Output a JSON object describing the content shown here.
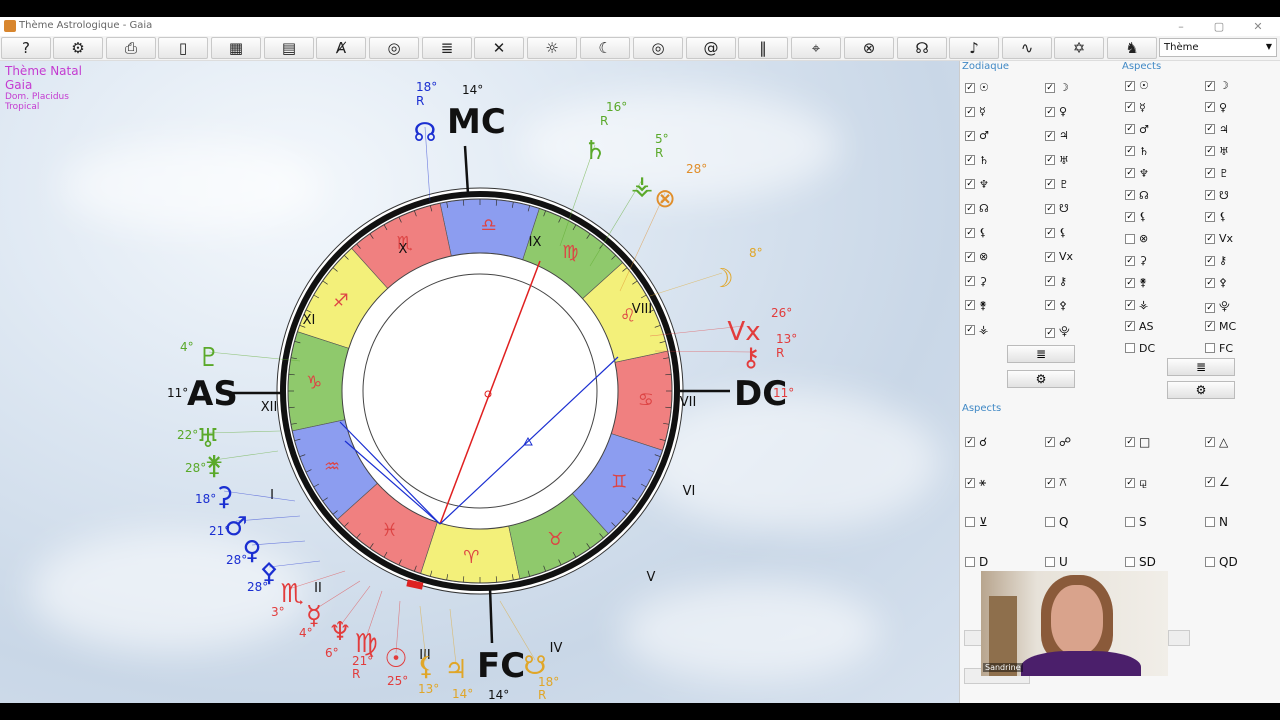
{
  "window": {
    "title": "Thème Astrologique - Gaia"
  },
  "toolbar": {
    "buttons": [
      {
        "name": "help-button",
        "glyph": "?"
      },
      {
        "name": "settings-button",
        "glyph": "⚙"
      },
      {
        "name": "print-button",
        "glyph": "⎙"
      },
      {
        "name": "export-button",
        "glyph": "▯"
      },
      {
        "name": "calculator-button",
        "glyph": "▦"
      },
      {
        "name": "clipboard-button",
        "glyph": "▤"
      },
      {
        "name": "compass-button",
        "glyph": "Ⱥ"
      },
      {
        "name": "spiral-target-button",
        "glyph": "◎"
      },
      {
        "name": "table-button",
        "glyph": "≣"
      },
      {
        "name": "transit-button",
        "glyph": "✕"
      },
      {
        "name": "calendar-sun-button",
        "glyph": "☼"
      },
      {
        "name": "calendar-moon-button",
        "glyph": "☾"
      },
      {
        "name": "circles-button",
        "glyph": "◎"
      },
      {
        "name": "spiral-button",
        "glyph": "@"
      },
      {
        "name": "bars-button",
        "glyph": "‖"
      },
      {
        "name": "cursor-button",
        "glyph": "⌖"
      },
      {
        "name": "cross-circle-button",
        "glyph": "⊗"
      },
      {
        "name": "node-button",
        "glyph": "☊"
      },
      {
        "name": "guitar-button",
        "glyph": "♪"
      },
      {
        "name": "serpent-button",
        "glyph": "∿"
      },
      {
        "name": "star-button",
        "glyph": "✡"
      },
      {
        "name": "family-button",
        "glyph": "♞"
      }
    ],
    "theme_select": "Thème"
  },
  "chart": {
    "info": {
      "title": "Thème Natal",
      "name": "Gaia",
      "houses": "Dom. Placidus",
      "zodiac": "Tropical"
    },
    "houses": [
      "I",
      "II",
      "III",
      "IV",
      "V",
      "VI",
      "VII",
      "VIII",
      "IX",
      "X",
      "XI",
      "XII"
    ],
    "angles": {
      "mc": {
        "glyph": "MC",
        "deg": "14°"
      },
      "dc": {
        "glyph": "DC",
        "deg": "11°"
      },
      "as": {
        "glyph": "AS",
        "deg": "11°"
      },
      "fc": {
        "glyph": "FC",
        "deg": "14°"
      }
    },
    "planets": [
      {
        "glyph": "☊",
        "deg": "18°",
        "retro": "R",
        "color": "#1b2fd1"
      },
      {
        "glyph": "♄",
        "deg": "16°",
        "retro": "R",
        "color": "#5aa92a"
      },
      {
        "glyph": "⚶",
        "deg": "5°",
        "retro": "R",
        "color": "#5aa92a"
      },
      {
        "glyph": "⊗",
        "deg": "28°",
        "retro": "",
        "color": "#e08e2b"
      },
      {
        "glyph": "☽",
        "deg": "8°",
        "retro": "",
        "color": "#e0a628"
      },
      {
        "glyph": "Vx",
        "deg": "26°",
        "retro": "",
        "color": "#e23c3c"
      },
      {
        "glyph": "⚷",
        "deg": "13°",
        "retro": "R",
        "color": "#e23c3c"
      },
      {
        "glyph": "♇",
        "deg": "4°",
        "retro": "",
        "color": "#5aa92a"
      },
      {
        "glyph": "♅",
        "deg": "22°",
        "retro": "",
        "color": "#5aa92a"
      },
      {
        "glyph": "⚵",
        "deg": "28°",
        "retro": "",
        "color": "#5aa92a"
      },
      {
        "glyph": "⚳",
        "deg": "18°",
        "retro": "",
        "color": "#1b2fd1"
      },
      {
        "glyph": "♂",
        "deg": "21°",
        "retro": "",
        "color": "#1b2fd1"
      },
      {
        "glyph": "♀",
        "deg": "28°",
        "retro": "",
        "color": "#1b2fd1"
      },
      {
        "glyph": "⚴",
        "deg": "28°",
        "retro": "",
        "color": "#1b2fd1"
      },
      {
        "glyph": "♏",
        "deg": "3°",
        "retro": "",
        "color": "#e23c3c"
      },
      {
        "glyph": "☿",
        "deg": "4°",
        "retro": "",
        "color": "#e23c3c"
      },
      {
        "glyph": "♆",
        "deg": "6°",
        "retro": "",
        "color": "#e23c3c"
      },
      {
        "glyph": "♍",
        "deg": "21°",
        "retro": "R",
        "color": "#e23c3c"
      },
      {
        "glyph": "☉",
        "deg": "25°",
        "retro": "",
        "color": "#e23c3c"
      },
      {
        "glyph": "⚸",
        "deg": "13°",
        "retro": "",
        "color": "#e0a628"
      },
      {
        "glyph": "♃",
        "deg": "14°",
        "retro": "",
        "color": "#e0a628"
      },
      {
        "glyph": "☋",
        "deg": "18°",
        "retro": "R",
        "color": "#e0a628"
      }
    ]
  },
  "panel": {
    "zodiac_title": "Zodiaque",
    "aspects_title": "Aspects",
    "zodiac_col1": [
      {
        "g": "☉",
        "c": true
      },
      {
        "g": "☿",
        "c": true
      },
      {
        "g": "♂",
        "c": true
      },
      {
        "g": "♄",
        "c": true
      },
      {
        "g": "♆",
        "c": true
      },
      {
        "g": "☊",
        "c": true
      },
      {
        "g": "⚸",
        "c": true
      },
      {
        "g": "⊗",
        "c": true
      },
      {
        "g": "⚳",
        "c": true
      },
      {
        "g": "⚵",
        "c": true
      },
      {
        "g": "⚶",
        "c": true
      }
    ],
    "zodiac_col2": [
      {
        "g": "☽",
        "c": true
      },
      {
        "g": "♀",
        "c": true
      },
      {
        "g": "♃",
        "c": true
      },
      {
        "g": "♅",
        "c": true
      },
      {
        "g": "♇",
        "c": true
      },
      {
        "g": "☋",
        "c": true
      },
      {
        "g": "⚸",
        "c": true
      },
      {
        "g": "Vx",
        "c": true
      },
      {
        "g": "⚷",
        "c": true
      },
      {
        "g": "⚴",
        "c": true
      },
      {
        "g": "⯓",
        "c": true
      }
    ],
    "aspects_col1": [
      {
        "g": "☉",
        "c": true
      },
      {
        "g": "☿",
        "c": true
      },
      {
        "g": "♂",
        "c": true
      },
      {
        "g": "♄",
        "c": true
      },
      {
        "g": "♆",
        "c": true
      },
      {
        "g": "☊",
        "c": true
      },
      {
        "g": "⚸",
        "c": true
      },
      {
        "g": "⊗",
        "c": false
      },
      {
        "g": "⚳",
        "c": true
      },
      {
        "g": "⚵",
        "c": true
      },
      {
        "g": "⚶",
        "c": true
      },
      {
        "g": "AS",
        "c": true
      },
      {
        "g": "DC",
        "c": false
      }
    ],
    "aspects_col2": [
      {
        "g": "☽",
        "c": true
      },
      {
        "g": "♀",
        "c": true
      },
      {
        "g": "♃",
        "c": true
      },
      {
        "g": "♅",
        "c": true
      },
      {
        "g": "♇",
        "c": true
      },
      {
        "g": "☋",
        "c": true
      },
      {
        "g": "⚸",
        "c": true
      },
      {
        "g": "Vx",
        "c": true
      },
      {
        "g": "⚷",
        "c": true
      },
      {
        "g": "⚴",
        "c": true
      },
      {
        "g": "⯓",
        "c": true
      },
      {
        "g": "MC",
        "c": true
      },
      {
        "g": "FC",
        "c": false
      }
    ],
    "aspect_types_title": "Aspects",
    "aspect_types": [
      {
        "g": "☌",
        "c": true
      },
      {
        "g": "☍",
        "c": true
      },
      {
        "g": "□",
        "c": true
      },
      {
        "g": "△",
        "c": true
      },
      {
        "g": "⚹",
        "c": true
      },
      {
        "g": "⚻",
        "c": true
      },
      {
        "g": "⚼",
        "c": true
      },
      {
        "g": "∠",
        "c": true
      },
      {
        "g": "⊻",
        "c": false
      },
      {
        "g": "Q",
        "c": false
      },
      {
        "g": "S",
        "c": false
      },
      {
        "g": "N",
        "c": false
      },
      {
        "g": "D",
        "c": false
      },
      {
        "g": "U",
        "c": false
      },
      {
        "g": "SD",
        "c": false
      },
      {
        "g": "QD",
        "c": false
      }
    ]
  },
  "video": {
    "participant": "Sandrine"
  },
  "colors": {
    "fire": "#f08080",
    "earth": "#f3f07a",
    "air": "#8fc96c",
    "water": "#8c9df0",
    "accent": "#3f88c5",
    "info": "#c43bd1"
  }
}
